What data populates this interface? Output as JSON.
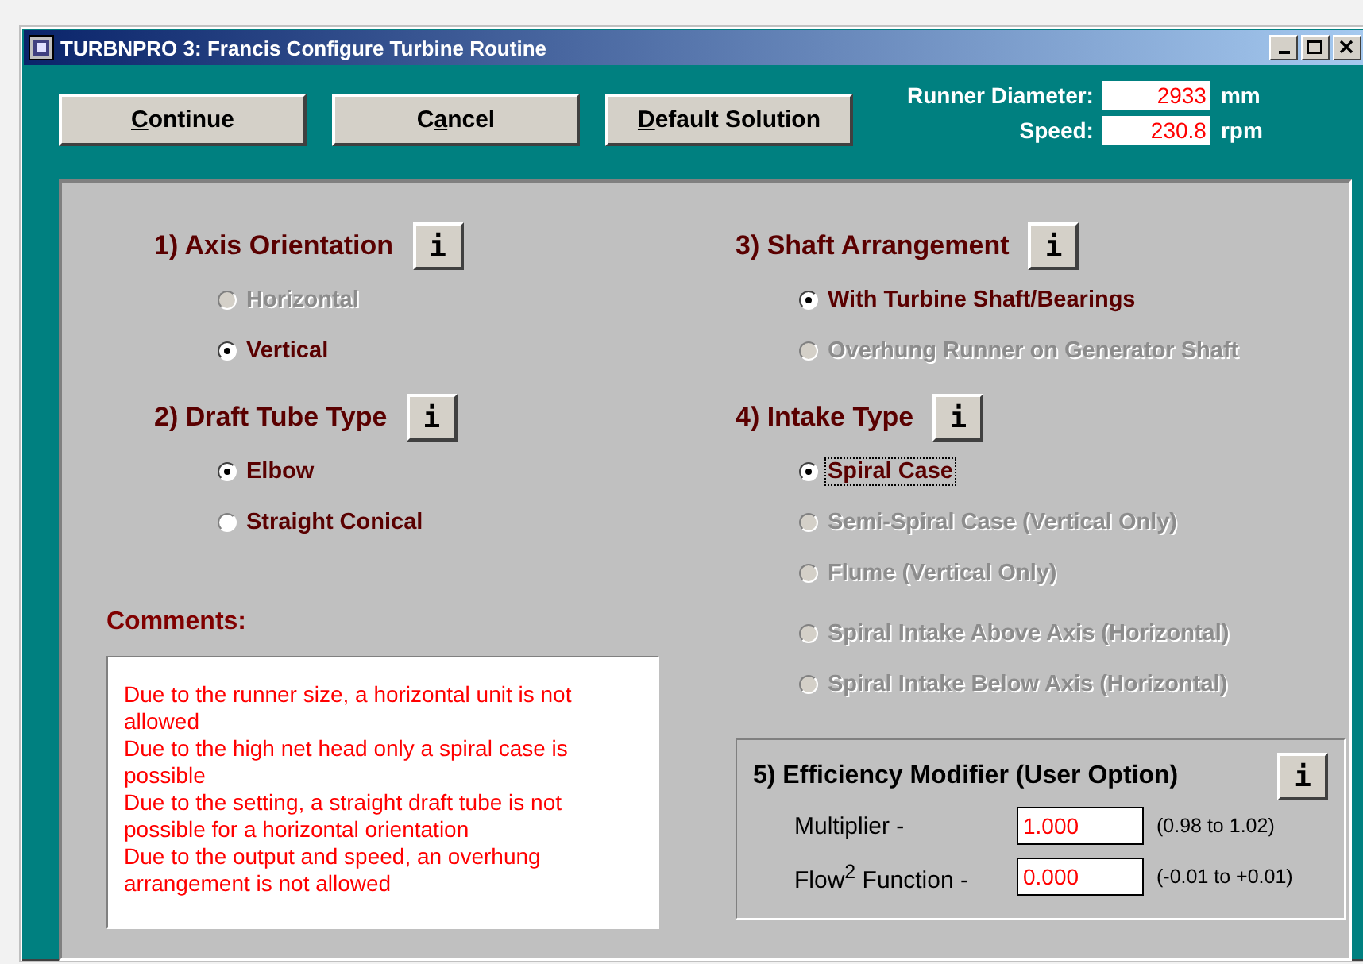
{
  "window": {
    "title": "TURBNPRO 3: Francis Configure Turbine Routine"
  },
  "buttons": [
    {
      "mnemonic": "C",
      "rest": "ontinue"
    },
    {
      "lead": "C",
      "mnemonic": "a",
      "rest": "ncel"
    },
    {
      "mnemonic": "D",
      "rest": "efault Solution"
    }
  ],
  "readouts": [
    {
      "label": "Runner Diameter:",
      "value": "2933",
      "unit": "mm"
    },
    {
      "label": "Speed:",
      "value": "230.8",
      "unit": "rpm"
    }
  ],
  "left_groups": [
    {
      "title": "1) Axis Orientation",
      "info": "i",
      "options": [
        {
          "label": "Horizontal",
          "selected": false,
          "disabled": true,
          "focused": false
        },
        {
          "label": "Vertical",
          "selected": true,
          "disabled": false,
          "focused": false
        }
      ]
    },
    {
      "title": "2) Draft Tube Type",
      "info": "i",
      "options": [
        {
          "label": "Elbow",
          "selected": true,
          "disabled": false,
          "focused": false
        },
        {
          "label": "Straight Conical",
          "selected": false,
          "disabled": false,
          "focused": false
        }
      ]
    }
  ],
  "right_groups": [
    {
      "title": "3) Shaft Arrangement",
      "info": "i",
      "options": [
        {
          "label": "With Turbine Shaft/Bearings",
          "selected": true,
          "disabled": false,
          "focused": false
        },
        {
          "label": "Overhung Runner on Generator Shaft",
          "selected": false,
          "disabled": true,
          "focused": false
        }
      ]
    },
    {
      "title": "4) Intake Type",
      "info": "i",
      "options": [
        {
          "label": "Spiral Case",
          "selected": true,
          "disabled": false,
          "focused": true
        },
        {
          "label": "Semi-Spiral Case (Vertical Only)",
          "selected": false,
          "disabled": true,
          "focused": false
        },
        {
          "label": "Flume (Vertical Only)",
          "selected": false,
          "disabled": true,
          "focused": false
        },
        {
          "label": "Spiral Intake Above Axis (Horizontal)",
          "selected": false,
          "disabled": true,
          "focused": false
        },
        {
          "label": "Spiral Intake Below Axis (Horizontal)",
          "selected": false,
          "disabled": true,
          "focused": false
        }
      ]
    }
  ],
  "comments": {
    "title": "Comments:",
    "lines": [
      "Due to the runner size, a horizontal unit is not allowed",
      "Due to the high net head only a spiral case is possible",
      "Due to the setting, a straight draft tube is not possible for a horizontal orientation",
      "Due to the output and speed, an overhung arrangement is not allowed"
    ]
  },
  "efficiency": {
    "title": "5) Efficiency Modifier (User Option)",
    "info": "i",
    "fields": [
      {
        "label": "Multiplier -",
        "value": "1.000",
        "range": "(0.98 to 1.02)"
      },
      {
        "label": "Flow$^{2}$ Function -",
        "value": "0.000",
        "range": "(-0.01 to +0.01)"
      }
    ]
  }
}
